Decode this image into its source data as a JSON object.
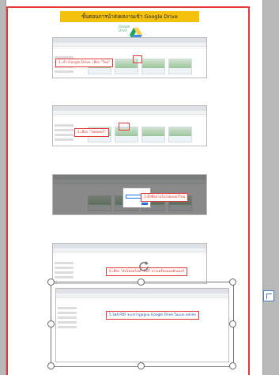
{
  "title": "ขั้นตอนการนำส่งผลงานเข้า Google Drive",
  "logo": {
    "line1": "Google",
    "line2": "Drive"
  },
  "steps": [
    {
      "label": "1.เข้า Google Drive, เลือก \"ใหม่\""
    },
    {
      "label": "2.เลือก \"โฟลเดอร์\""
    },
    {
      "label": "3.ตั้งชื่อตามในโฟลเดอร์ใหม่"
    },
    {
      "label": "4.เลือก \"อัปโหลดไฟล์\" PDF จากเครื่องคอมพิวเตอร์"
    },
    {
      "label": "5.ไฟล์ PDF จะปรากฏอยู่บน Google Drive ในแบบ online"
    }
  ],
  "colors": {
    "frame": "#e53935",
    "title_bg": "#f4c20d",
    "drive_green": "#1fa463",
    "drive_yellow": "#ffd04b",
    "drive_blue": "#4688f4"
  },
  "icons": [
    "google-drive-icon",
    "rotate-icon",
    "layout-options-icon"
  ]
}
